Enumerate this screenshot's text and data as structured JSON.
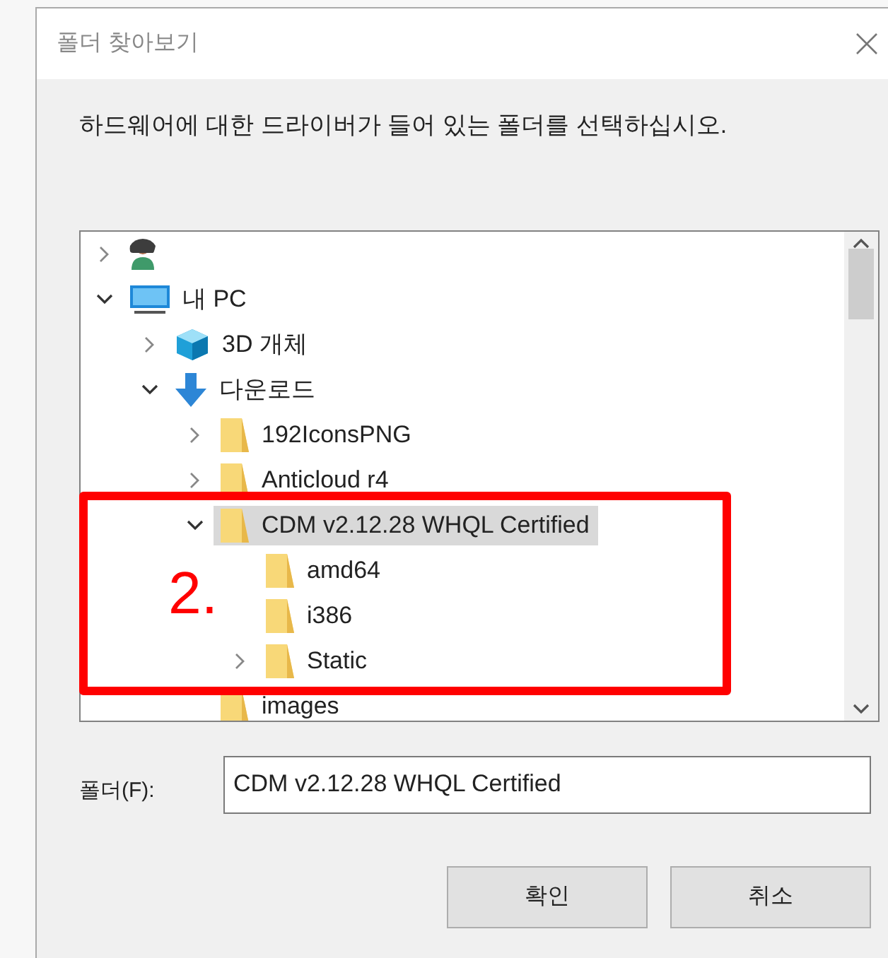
{
  "window": {
    "title": "폴더 찾아보기"
  },
  "instruction": "하드웨어에 대한 드라이버가 들어 있는 폴더를 선택하십시오.",
  "tree": [
    {
      "kind": "user",
      "expanded": false,
      "selected": false
    },
    {
      "label": "내 PC",
      "kind": "pc",
      "expanded": true,
      "selected": false,
      "children": [
        {
          "label": "3D 개체",
          "kind": "cube",
          "expanded": false,
          "selected": false
        },
        {
          "label": "다운로드",
          "kind": "download",
          "expanded": true,
          "selected": false,
          "children": [
            {
              "label": "192IconsPNG",
              "kind": "folder",
              "expanded": false,
              "selected": false
            },
            {
              "label": "Anticloud r4",
              "kind": "folder",
              "expanded": false,
              "selected": false
            },
            {
              "label": "CDM v2.12.28 WHQL Certified",
              "kind": "folder",
              "expanded": true,
              "selected": true,
              "children": [
                {
                  "label": "amd64",
                  "kind": "folder",
                  "selected": false
                },
                {
                  "label": "i386",
                  "kind": "folder",
                  "selected": false
                },
                {
                  "label": "Static",
                  "kind": "folder",
                  "expanded": false,
                  "selected": false
                }
              ]
            },
            {
              "label": "images",
              "kind": "folder",
              "selected": false
            }
          ]
        }
      ]
    }
  ],
  "folder_field": {
    "label": "폴더(F):",
    "value": "CDM v2.12.28 WHQL Certified"
  },
  "buttons": [
    "확인",
    "취소"
  ],
  "annotation": {
    "label": "2."
  }
}
